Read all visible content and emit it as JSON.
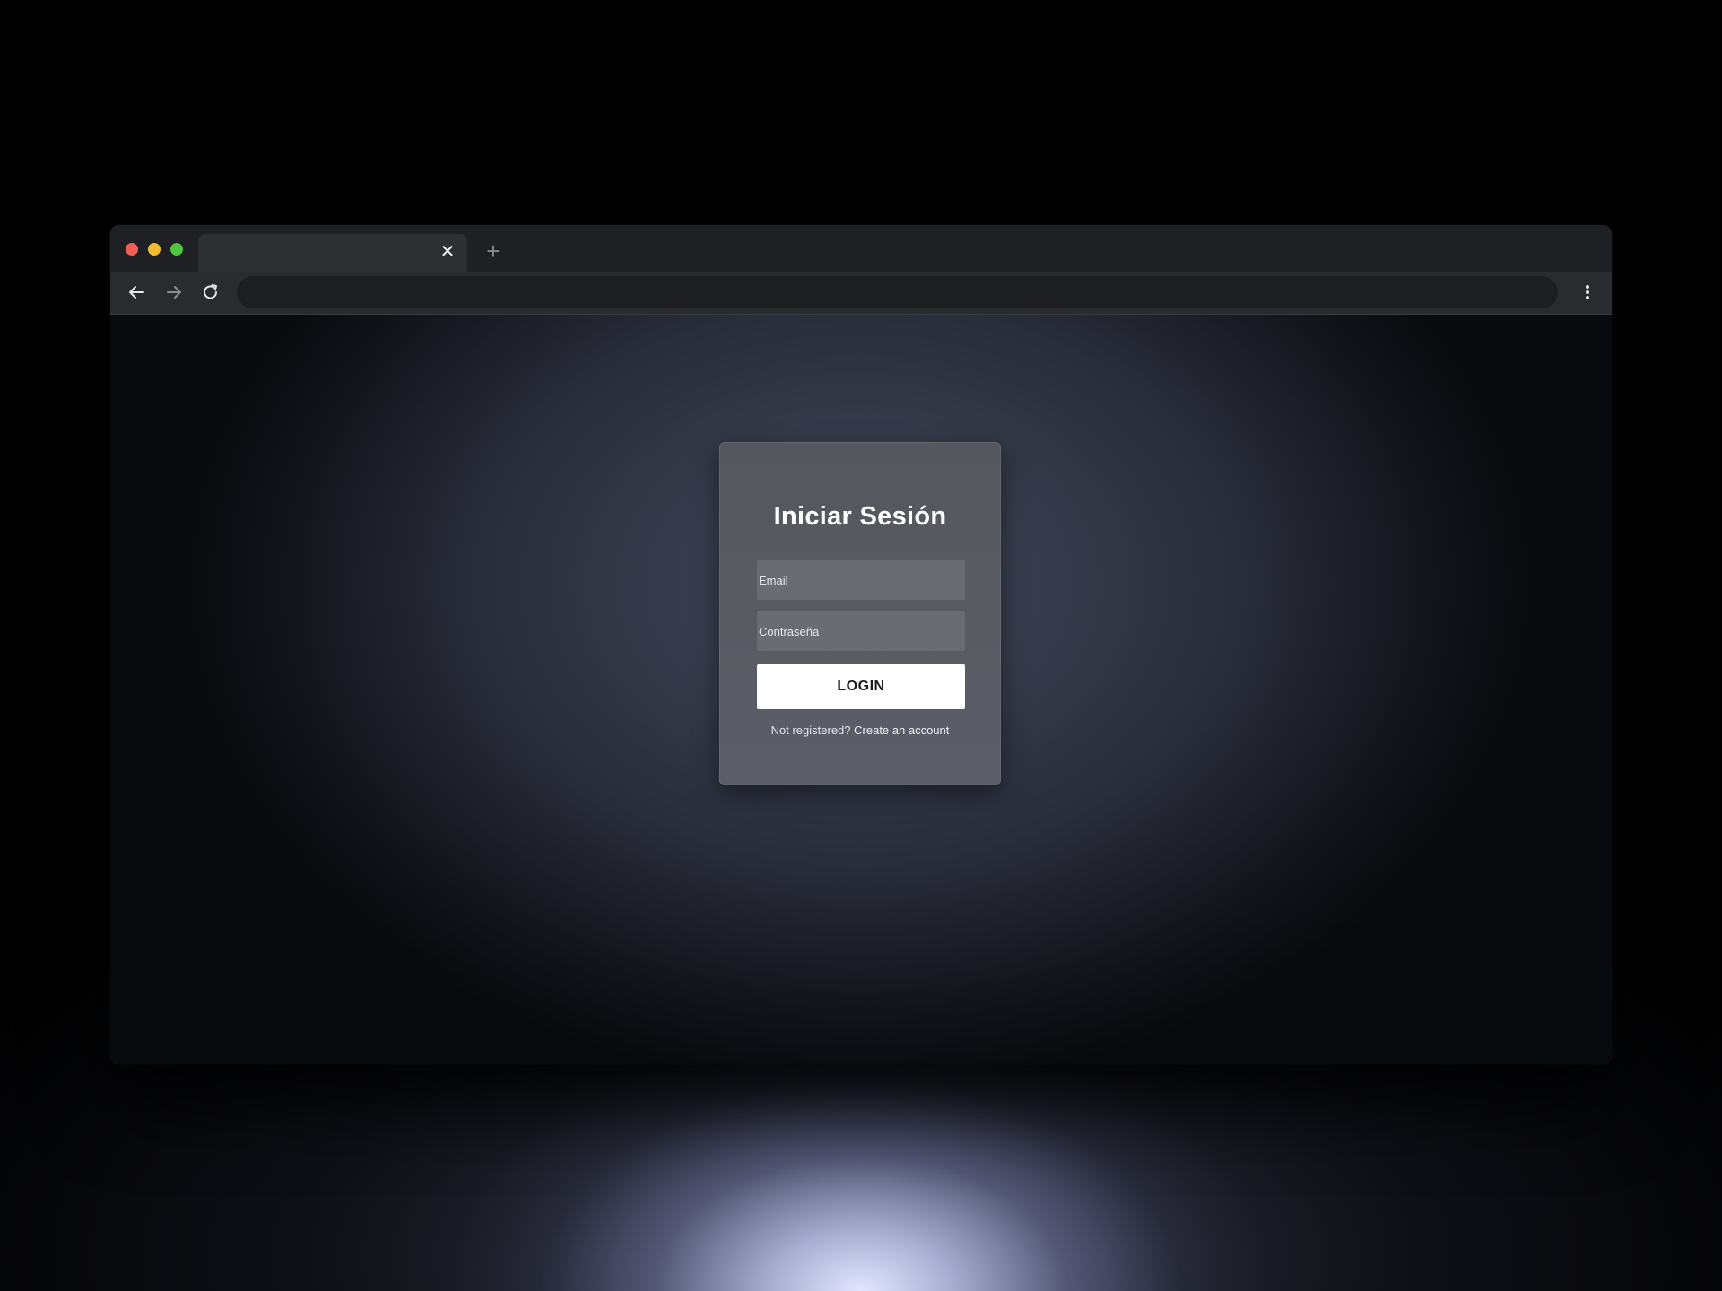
{
  "browser": {
    "tab_close_glyph": "✕",
    "new_tab_glyph": "+",
    "address": "",
    "icons": {
      "back": "arrow-left-icon",
      "forward": "arrow-right-icon",
      "reload": "reload-icon",
      "menu": "kebab-menu-icon"
    }
  },
  "login": {
    "title": "Iniciar Sesión",
    "email_placeholder": "Email",
    "password_placeholder": "Contraseña",
    "button_label": "LOGIN",
    "prompt_text": "Not registered?",
    "link_text": "Create an account"
  },
  "colors": {
    "traffic_close": "#ee5f57",
    "traffic_minimize": "#f3bc2f",
    "traffic_maximize": "#4fc63c",
    "button_bg": "#ffffff"
  }
}
